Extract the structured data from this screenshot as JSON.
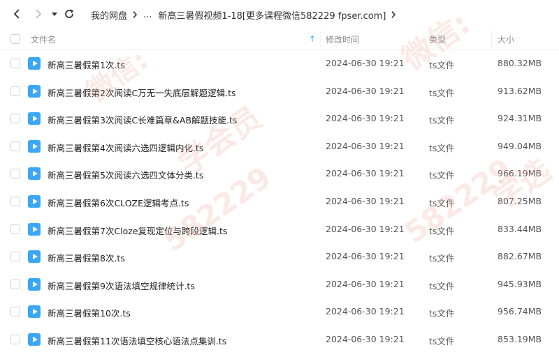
{
  "breadcrumb": {
    "root": "我的网盘",
    "ellipsis": "...",
    "current": "新高三暑假视频1-18[更多课程微信582229 fpser.com]"
  },
  "columns": {
    "name": "文件名",
    "modified": "修改时间",
    "type": "类型",
    "size": "大小",
    "sort_indicator": "↑"
  },
  "files": [
    {
      "name": "新高三暑假第1次.ts",
      "modified": "2024-06-30 19:21",
      "type": "ts文件",
      "size": "880.32MB"
    },
    {
      "name": "新高三暑假第2次阅读C万无一失底层解题逻辑.ts",
      "modified": "2024-06-30 19:21",
      "type": "ts文件",
      "size": "913.62MB"
    },
    {
      "name": "新高三暑假第3次阅读C长难篇章&AB解题技能.ts",
      "modified": "2024-06-30 19:21",
      "type": "ts文件",
      "size": "924.31MB"
    },
    {
      "name": "新高三暑假第4次阅读六选四逻辑内化.ts",
      "modified": "2024-06-30 19:21",
      "type": "ts文件",
      "size": "949.04MB"
    },
    {
      "name": "新高三暑假第5次阅读六选四文体分类.ts",
      "modified": "2024-06-30 19:21",
      "type": "ts文件",
      "size": "966.19MB"
    },
    {
      "name": "新高三暑假第6次CLOZE逻辑考点.ts",
      "modified": "2024-06-30 19:21",
      "type": "ts文件",
      "size": "807.25MB"
    },
    {
      "name": "新高三暑假第7次Cloze复现定位与跨段逻辑.ts",
      "modified": "2024-06-30 19:21",
      "type": "ts文件",
      "size": "833.44MB"
    },
    {
      "name": "新高三暑假第8次.ts",
      "modified": "2024-06-30 19:21",
      "type": "ts文件",
      "size": "882.67MB"
    },
    {
      "name": "新高三暑假第9次语法填空规律统计.ts",
      "modified": "2024-06-30 19:21",
      "type": "ts文件",
      "size": "945.93MB"
    },
    {
      "name": "新高三暑假第10次.ts",
      "modified": "2024-06-30 19:21",
      "type": "ts文件",
      "size": "956.74MB"
    },
    {
      "name": "新高三暑假第11次语法填空核心语法点集训.ts",
      "modified": "2024-06-30 19:21",
      "type": "ts文件",
      "size": "853.19MB"
    }
  ],
  "watermarks": [
    "微信:",
    "582229",
    "学会员",
    "微信:",
    "582229",
    "学选"
  ],
  "colors": {
    "accent": "#3aa7f5",
    "watermark": "#eeafa0"
  },
  "icons": {
    "back": "chevron-left-icon",
    "forward": "chevron-right-icon",
    "dropdown": "caret-down-icon",
    "refresh": "refresh-icon",
    "file": "video-file-icon"
  }
}
